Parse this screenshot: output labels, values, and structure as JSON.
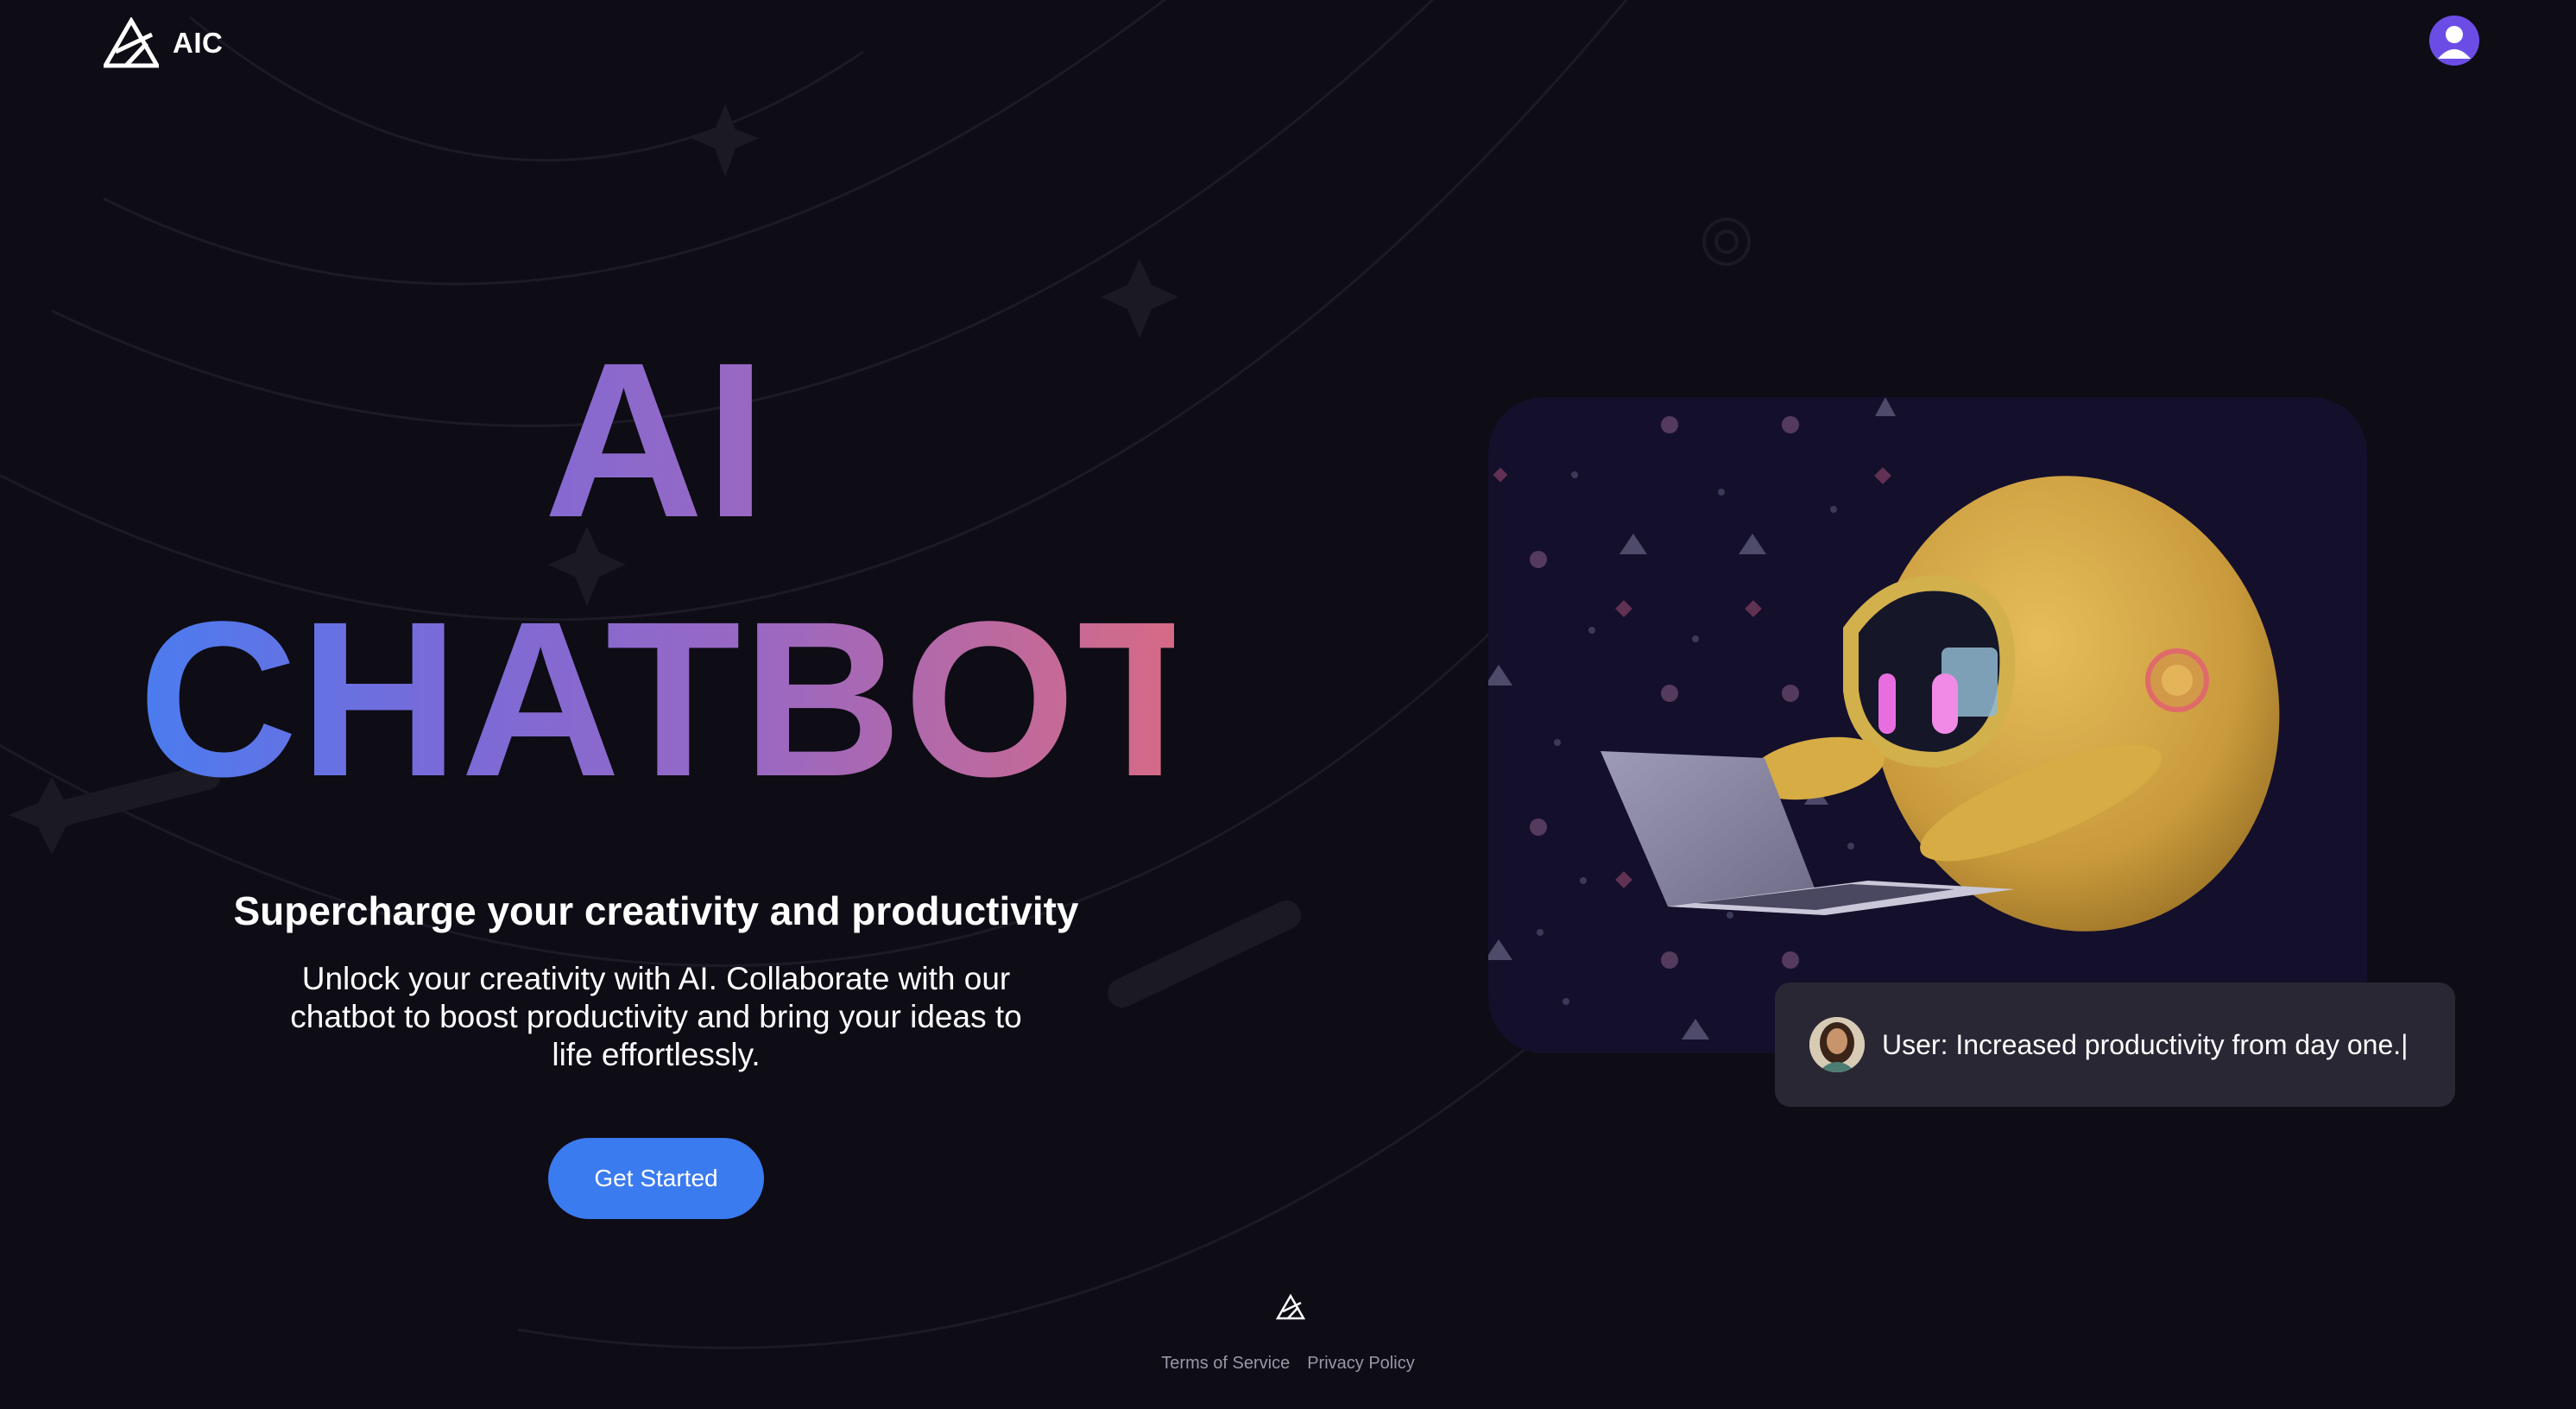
{
  "header": {
    "brand_name": "AIC",
    "logo_icon": "aic-logo-icon",
    "profile_icon": "user-avatar-icon"
  },
  "hero": {
    "title_line1": "AI",
    "title_line2": "CHATBOT",
    "subtitle": "Supercharge your creativity and productivity",
    "description": "Unlock your creativity with AI. Collaborate with our chatbot to boost productivity and bring your ideas to life effortlessly.",
    "cta_label": "Get Started"
  },
  "illustration": {
    "image": "robot-with-laptop-illustration"
  },
  "chat_bubble": {
    "text": "User: Increased productivity from day one.|",
    "avatar_icon": "user-avatar-photo"
  },
  "footer": {
    "logo_icon": "aic-logo-icon",
    "links": [
      "Terms of Service",
      "Privacy Policy"
    ]
  },
  "colors": {
    "background": "#0e0c15",
    "accent_blue": "#3b7bf0",
    "gradient_start": "#4a7cf0",
    "gradient_end": "#d66a86",
    "card_background": "#140f2b",
    "bubble_background": "#2a2734"
  }
}
